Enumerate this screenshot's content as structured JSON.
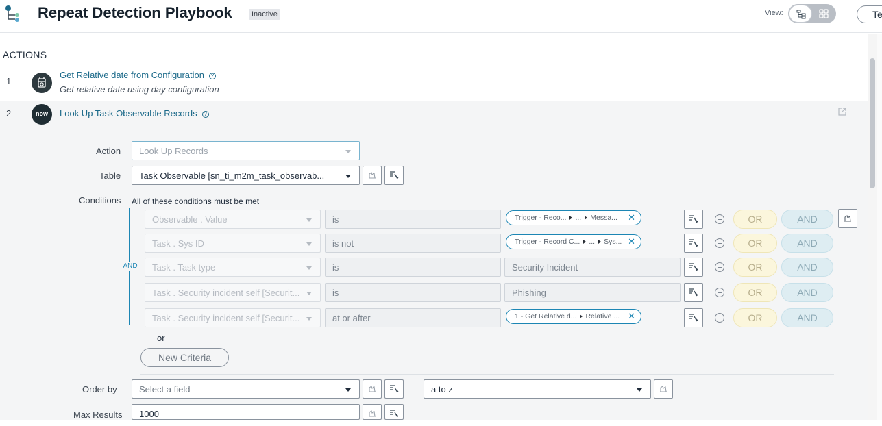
{
  "header": {
    "title": "Repeat Detection Playbook",
    "status_badge": "Inactive",
    "view_label": "View:",
    "test_button": "Te"
  },
  "actions": {
    "heading": "ACTIONS",
    "steps": [
      {
        "number": "1",
        "title": "Get Relative date from Configuration",
        "description": "Get relative date using day configuration",
        "icon": "config-icon"
      },
      {
        "number": "2",
        "title": "Look Up Task Observable Records",
        "icon_text": "now"
      }
    ]
  },
  "form": {
    "action_label": "Action",
    "action_value": "Look Up Records",
    "table_label": "Table",
    "table_value": "Task Observable [sn_ti_m2m_task_observab...",
    "conditions_label": "Conditions",
    "conditions_caption": "All of these conditions must be met",
    "and_label": "AND",
    "or_button": "OR",
    "and_button": "AND",
    "conditions": [
      {
        "field": "Observable . Value",
        "operator": "is",
        "pill": [
          "Trigger - Reco...",
          "...",
          "Messa..."
        ]
      },
      {
        "field": "Task . Sys ID",
        "operator": "is not",
        "pill": [
          "Trigger - Record C...",
          "...",
          "Sys..."
        ]
      },
      {
        "field": "Task . Task type",
        "operator": "is",
        "value": "Security Incident"
      },
      {
        "field": "Task . Security incident self [Securit...",
        "operator": "is",
        "value": "Phishing"
      },
      {
        "field": "Task . Security incident self [Securit...",
        "operator": "at or after",
        "pill": [
          "1 - Get Relative d...",
          "Relative ..."
        ]
      }
    ],
    "or_separator": "or",
    "new_criteria": "New Criteria",
    "order_by_label": "Order by",
    "order_by_placeholder": "Select a field",
    "order_direction": "a to z",
    "max_results_label": "Max Results",
    "max_results_value": "1000"
  },
  "colors": {
    "link": "#1c6a8a",
    "accent": "#1c86b4",
    "panel": "#f4f5f6"
  }
}
